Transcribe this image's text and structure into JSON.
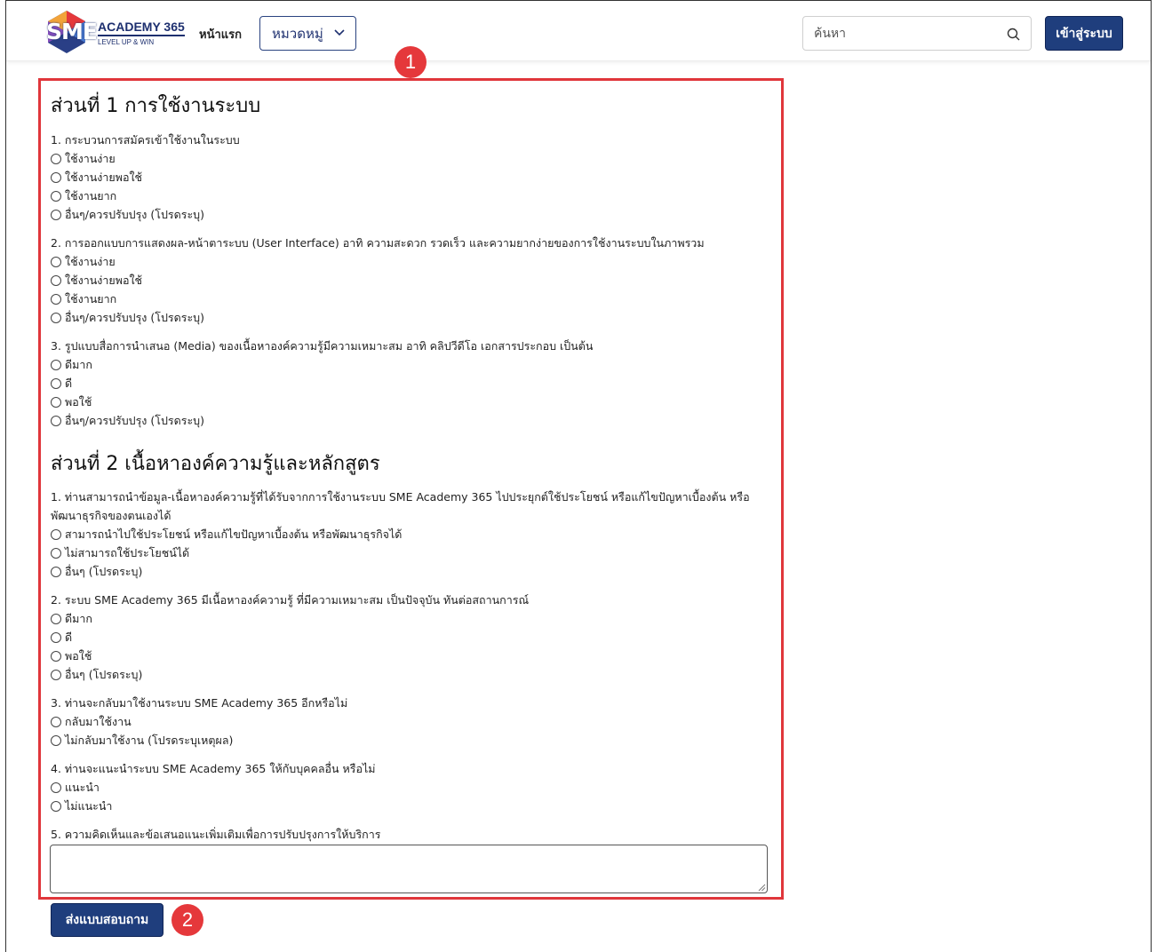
{
  "header": {
    "logo_mark": "SME",
    "logo_title": "ACADEMY 365",
    "logo_tagline": "LEVEL UP & WIN",
    "nav_home": "หน้าแรก",
    "nav_category": "หมวดหมู่",
    "search_placeholder": "ค้นหา",
    "login_label": "เข้าสู่ระบบ"
  },
  "annotations": [
    "1",
    "2"
  ],
  "section1": {
    "title": "ส่วนที่ 1 การใช้งานระบบ",
    "questions": [
      {
        "text": "1. กระบวนการสมัครเข้าใช้งานในระบบ",
        "options": [
          "ใช้งานง่าย",
          "ใช้งานง่ายพอใช้",
          "ใช้งานยาก",
          "อื่นๆ/ควรปรับปรุง (โปรดระบุ)"
        ]
      },
      {
        "text": "2. การออกแบบการแสดงผล-หน้าตาระบบ (User Interface) อาทิ ความสะดวก รวดเร็ว และความยากง่ายของการใช้งานระบบในภาพรวม",
        "options": [
          "ใช้งานง่าย",
          "ใช้งานง่ายพอใช้",
          "ใช้งานยาก",
          "อื่นๆ/ควรปรับปรุง (โปรดระบุ)"
        ]
      },
      {
        "text": "3. รูปแบบสื่อการนำเสนอ (Media) ของเนื้อหาองค์ความรู้มีความเหมาะสม อาทิ คลิปวีดีโอ เอกสารประกอบ เป็นต้น",
        "options": [
          "ดีมาก",
          "ดี",
          "พอใช้",
          "อื่นๆ/ควรปรับปรุง (โปรดระบุ)"
        ]
      }
    ]
  },
  "section2": {
    "title": "ส่วนที่ 2 เนื้อหาองค์ความรู้และหลักสูตร",
    "questions": [
      {
        "text": "1. ท่านสามารถนำข้อมูล-เนื้อหาองค์ความรู้ที่ได้รับจากการใช้งานระบบ SME Academy 365 ไปประยุกต์ใช้ประโยชน์ หรือแก้ไขปัญหาเบื้องต้น หรือพัฒนาธุรกิจของตนเองได้",
        "options": [
          "สามารถนำไปใช้ประโยชน์ หรือแก้ไขปัญหาเบื้องต้น หรือพัฒนาธุรกิจได้",
          "ไม่สามารถใช้ประโยชน์ได้",
          "อื่นๆ (โปรดระบุ)"
        ]
      },
      {
        "text": "2. ระบบ SME Academy 365 มีเนื้อหาองค์ความรู้ ที่มีความเหมาะสม เป็นปัจจุบัน ทันต่อสถานการณ์",
        "options": [
          "ดีมาก",
          "ดี",
          "พอใช้",
          "อื่นๆ (โปรดระบุ)"
        ]
      },
      {
        "text": "3. ท่านจะกลับมาใช้งานระบบ SME Academy 365 อีกหรือไม่",
        "options": [
          "กลับมาใช้งาน",
          "ไม่กลับมาใช้งาน (โปรดระบุเหตุผล)"
        ]
      },
      {
        "text": "4. ท่านจะแนะนำระบบ SME Academy 365 ให้กับบุคคลอื่น หรือไม่",
        "options": [
          "แนะนำ",
          "ไม่แนะนำ"
        ]
      },
      {
        "text": "5. ความคิดเห็นและข้อเสนอแนะเพิ่มเติมเพื่อการปรับปรุงการให้บริการ",
        "options": []
      }
    ]
  },
  "submit_label": "ส่งแบบสอบถาม",
  "colors": {
    "brand_blue": "#1f3e7d",
    "highlight_red": "#e0363b"
  }
}
